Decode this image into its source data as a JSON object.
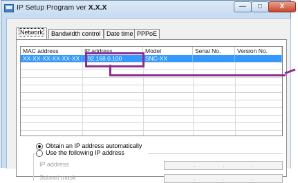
{
  "window": {
    "title_prefix": "IP Setup Program ver",
    "title_version": "X.X.X",
    "minimize": "—",
    "maximize": "□",
    "close": "X"
  },
  "tabs": [
    {
      "label": "Network",
      "active": true
    },
    {
      "label": "Bandwidth control",
      "active": false
    },
    {
      "label": "Date time",
      "active": false
    },
    {
      "label": "PPPoE",
      "active": false
    }
  ],
  "table": {
    "columns": [
      "MAC address",
      "IP address",
      "Model",
      "Serial No.",
      "Version No."
    ],
    "rows": [
      {
        "mac": "XX-XX-XX-XX-XX-XX",
        "ip": "192.168.0.100",
        "model": "SNC-XX",
        "serial": "",
        "version": "",
        "selected": true
      }
    ]
  },
  "ip_options": {
    "auto_label": "Obtain an IP address automatically",
    "auto_selected": true,
    "manual_label": "Use the following IP address",
    "manual_selected": false,
    "ip_address_label": "IP address",
    "subnet_mask_label": "Subnet mask"
  },
  "colors": {
    "selection": "#3399ff",
    "highlight": "#8e2d8f"
  }
}
